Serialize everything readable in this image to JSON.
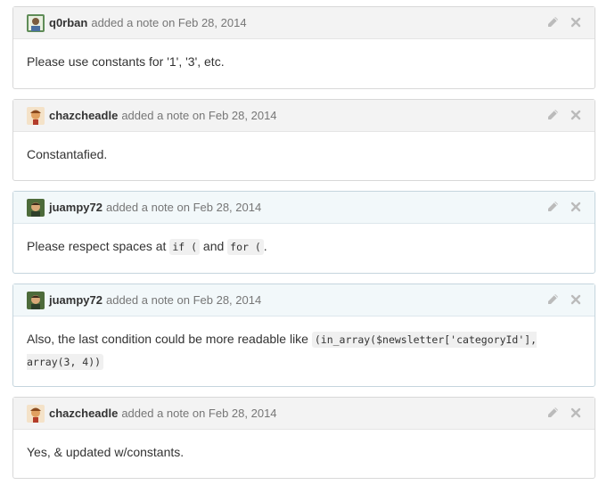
{
  "notes": [
    {
      "author": "q0rban",
      "meta": "added a note on Feb 28, 2014",
      "avatar_icon": "q0rban-avatar",
      "body_parts": [
        "Please use constants for '1', '3', etc."
      ]
    },
    {
      "author": "chazcheadle",
      "meta": "added a note on Feb 28, 2014",
      "avatar_icon": "chazcheadle-avatar",
      "body_parts": [
        "Constantafied."
      ]
    },
    {
      "author": "juampy72",
      "meta": "added a note on Feb 28, 2014",
      "avatar_icon": "juampy72-avatar",
      "body_parts": [
        "Please respect spaces at ",
        "if (",
        " and ",
        "for (",
        "."
      ]
    },
    {
      "author": "juampy72",
      "meta": "added a note on Feb 28, 2014",
      "avatar_icon": "juampy72-avatar",
      "body_parts": [
        "Also, the last condition could be more readable like ",
        "(in_array($newsletter['categoryId'], array(3, 4))"
      ]
    },
    {
      "author": "chazcheadle",
      "meta": "added a note on Feb 28, 2014",
      "avatar_icon": "chazcheadle-avatar",
      "body_parts": [
        "Yes, & updated w/constants."
      ]
    }
  ],
  "actions": {
    "edit_icon": "pencil-icon",
    "delete_icon": "close-icon"
  },
  "colors": {
    "header_bg": "#f3f3f3",
    "highlight_header_bg": "#f2f8fa",
    "meta_text": "#767676",
    "icon_gray": "#bbbbbb"
  }
}
